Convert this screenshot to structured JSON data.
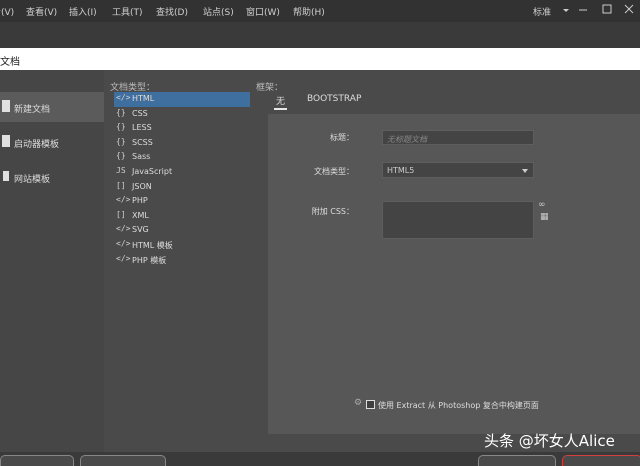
{
  "menubar": {
    "items": [
      "看(V)",
      "查看(V)",
      "插入(I)",
      "工具(T)",
      "查找(D)",
      "站点(S)",
      "窗口(W)",
      "帮助(H)"
    ],
    "standard": "标准"
  },
  "dialog_title": "文档",
  "left_column": [
    {
      "label": "新建文档",
      "icon": "file-icon",
      "selected": true
    },
    {
      "label": "启动器模板",
      "icon": "template-icon",
      "selected": false
    },
    {
      "label": "网站模板",
      "icon": "site-template-icon",
      "selected": false
    }
  ],
  "doctypes": {
    "label": "文档类型：",
    "items": [
      {
        "glyph": "</>",
        "name": "HTML",
        "selected": true
      },
      {
        "glyph": "{}",
        "name": "CSS"
      },
      {
        "glyph": "{}",
        "name": "LESS"
      },
      {
        "glyph": "{}",
        "name": "SCSS"
      },
      {
        "glyph": "{}",
        "name": "Sass"
      },
      {
        "glyph": "JS",
        "name": "JavaScript"
      },
      {
        "glyph": "[]",
        "name": "JSON"
      },
      {
        "glyph": "</>",
        "name": "PHP"
      },
      {
        "glyph": "[]",
        "name": "XML"
      },
      {
        "glyph": "</>",
        "name": "SVG"
      },
      {
        "glyph": "</>",
        "name": "HTML 模板"
      },
      {
        "glyph": "</>",
        "name": "PHP 模板"
      }
    ]
  },
  "framework": {
    "label": "框架：",
    "tabs": [
      "无",
      "BOOTSTRAP"
    ],
    "title_label": "标题：",
    "title_placeholder": "无标题文档",
    "doctype_label": "文档类型：",
    "doctype_value": "HTML5",
    "css_label": "附加 CSS：",
    "extract_label": "使用 Extract 从 Photoshop 复合中构建页面"
  },
  "watermark": "头条 @坏女人Alice"
}
